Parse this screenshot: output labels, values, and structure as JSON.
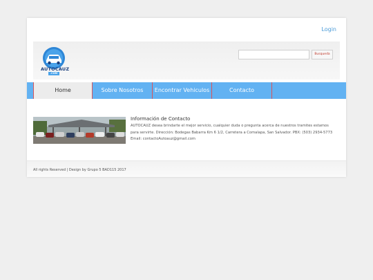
{
  "header": {
    "login_label": "Login",
    "logo_text": "AUTOCAUZ",
    "logo_sub": ".COM",
    "search_placeholder": "",
    "search_button": "Busqueda"
  },
  "nav": {
    "items": [
      {
        "label": "Home"
      },
      {
        "label": "Sobre Nosotros"
      },
      {
        "label": "Encontrar Vehiculos"
      },
      {
        "label": "Contacto"
      }
    ]
  },
  "contact": {
    "title": "Información de Contacto",
    "text": "AUTOCAUZ desea brindarte el mejor servicio, cualquier duda o pregunta acerca de nuestros tramites estamos para servirte. Dirección: Bodegas Babarra Km 6 1/2, Carretera a Comalapa, San Salvador. PBX: (503) 2934-5773 Email: contactoAutoauz@gmail.com"
  },
  "footer": {
    "text": "All rights Reserved | Design by Grupo 5 BAD115 2017"
  },
  "colors": {
    "nav": "#62b2f2",
    "nav_divider": "#d8545a",
    "link": "#4a9bd8"
  }
}
